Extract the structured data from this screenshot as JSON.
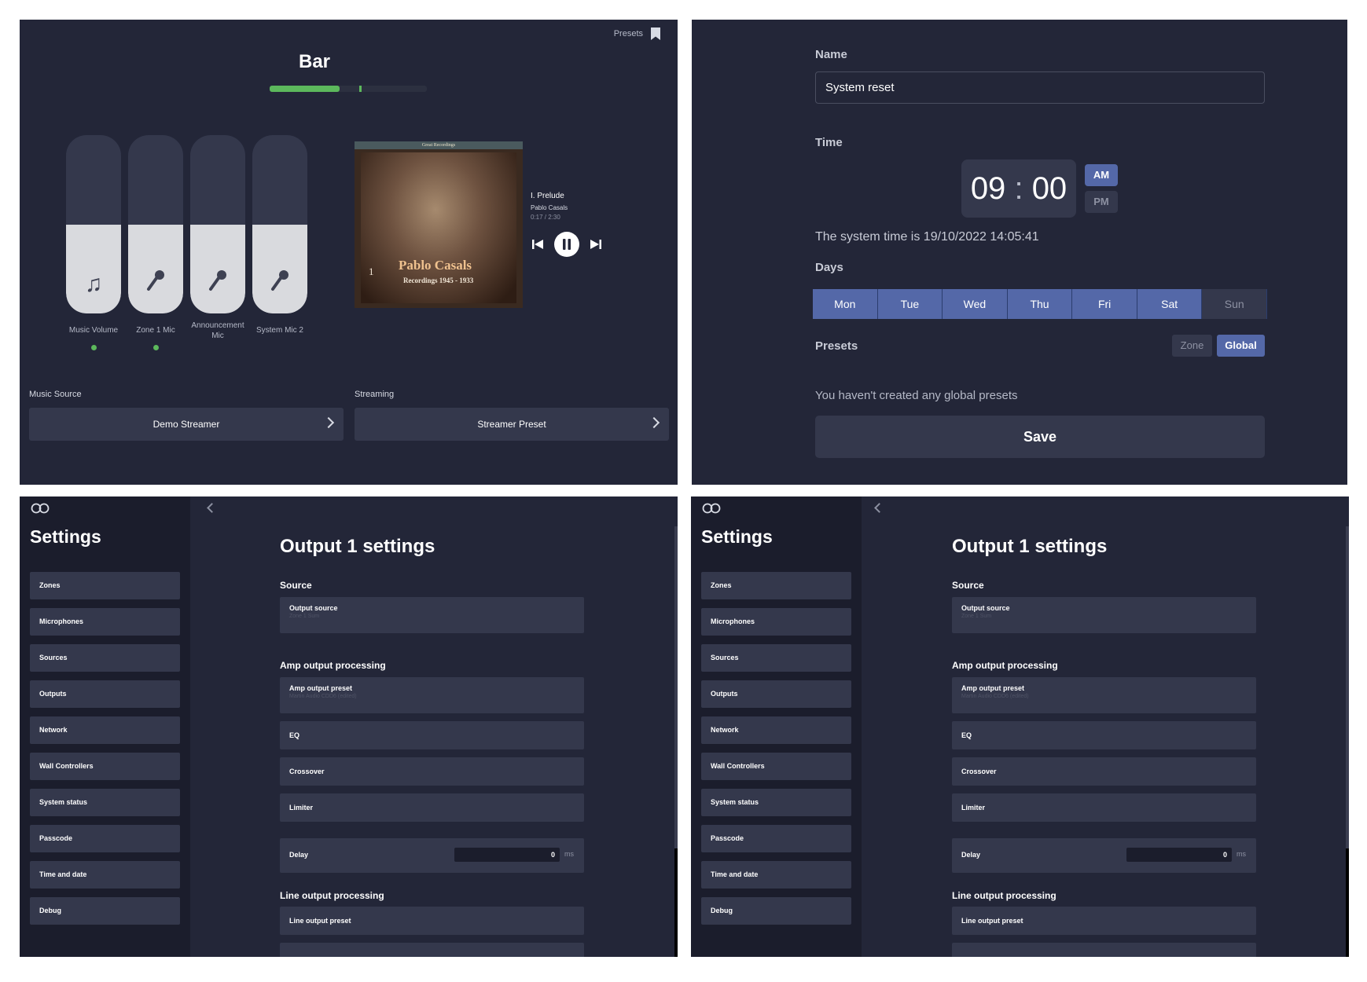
{
  "player": {
    "presets_label": "Presets",
    "zone_title": "Bar",
    "meter": {
      "level": 0.47,
      "peak": 0.61
    },
    "faders": [
      {
        "label": "Music Volume",
        "level": 0.5,
        "icon": "music-note-icon",
        "active": true
      },
      {
        "label": "Zone 1 Mic",
        "level": 0.5,
        "icon": "microphone-icon",
        "active": true
      },
      {
        "label": "Announcement Mic",
        "level": 0.5,
        "icon": "microphone-icon",
        "active": false
      },
      {
        "label": "System Mic 2",
        "level": 0.5,
        "icon": "microphone-icon",
        "active": false
      }
    ],
    "album": {
      "banner": "Great Recordings",
      "number": "1",
      "artist_art": "Pablo Casals",
      "sub_art": "Recordings 1945 - 1933"
    },
    "track": {
      "title": "I. Prelude",
      "artist": "Pablo Casals",
      "time": "0:17 / 2:30"
    },
    "music_source": {
      "label": "Music Source",
      "value": "Demo Streamer"
    },
    "streaming": {
      "label": "Streaming",
      "value": "Streamer Preset"
    }
  },
  "schedule": {
    "name_label": "Name",
    "name_value": "System reset",
    "time_label": "Time",
    "hours": "09",
    "separator": ":",
    "minutes": "00",
    "am": "AM",
    "pm": "PM",
    "selected_period": "AM",
    "system_time_text": "The system time is 19/10/2022 14:05:41",
    "days_label": "Days",
    "days": [
      {
        "label": "Mon",
        "selected": true
      },
      {
        "label": "Tue",
        "selected": true
      },
      {
        "label": "Wed",
        "selected": true
      },
      {
        "label": "Thu",
        "selected": true
      },
      {
        "label": "Fri",
        "selected": true
      },
      {
        "label": "Sat",
        "selected": true
      },
      {
        "label": "Sun",
        "selected": false
      }
    ],
    "presets_label": "Presets",
    "zone_btn": "Zone",
    "global_btn": "Global",
    "empty_text": "You haven't created any global presets",
    "save": "Save"
  },
  "settings": {
    "title": "Settings",
    "nav": [
      "Zones",
      "Microphones",
      "Sources",
      "Outputs",
      "Network",
      "Wall Controllers",
      "System status",
      "Passcode",
      "Time and date",
      "Debug"
    ],
    "output_title": "Output 1 settings",
    "source_head": "Source",
    "output_source": {
      "label": "Output source",
      "value": "Zone 1 Sum"
    },
    "amp_head": "Amp output processing",
    "amp_preset": {
      "label": "Amp output preset",
      "value": "Martin Audio CDD6 (edited)"
    },
    "eq": "EQ",
    "crossover": "Crossover",
    "limiter": "Limiter",
    "delay": {
      "label": "Delay",
      "value": "0",
      "unit": "ms"
    },
    "line_head": "Line output processing",
    "line_preset": "Line output preset"
  },
  "colors": {
    "panel": "#232638",
    "sidebar": "#1b1d2c",
    "control": "#34384c",
    "accent": "#5468a8",
    "level_green": "#5cb85c"
  }
}
